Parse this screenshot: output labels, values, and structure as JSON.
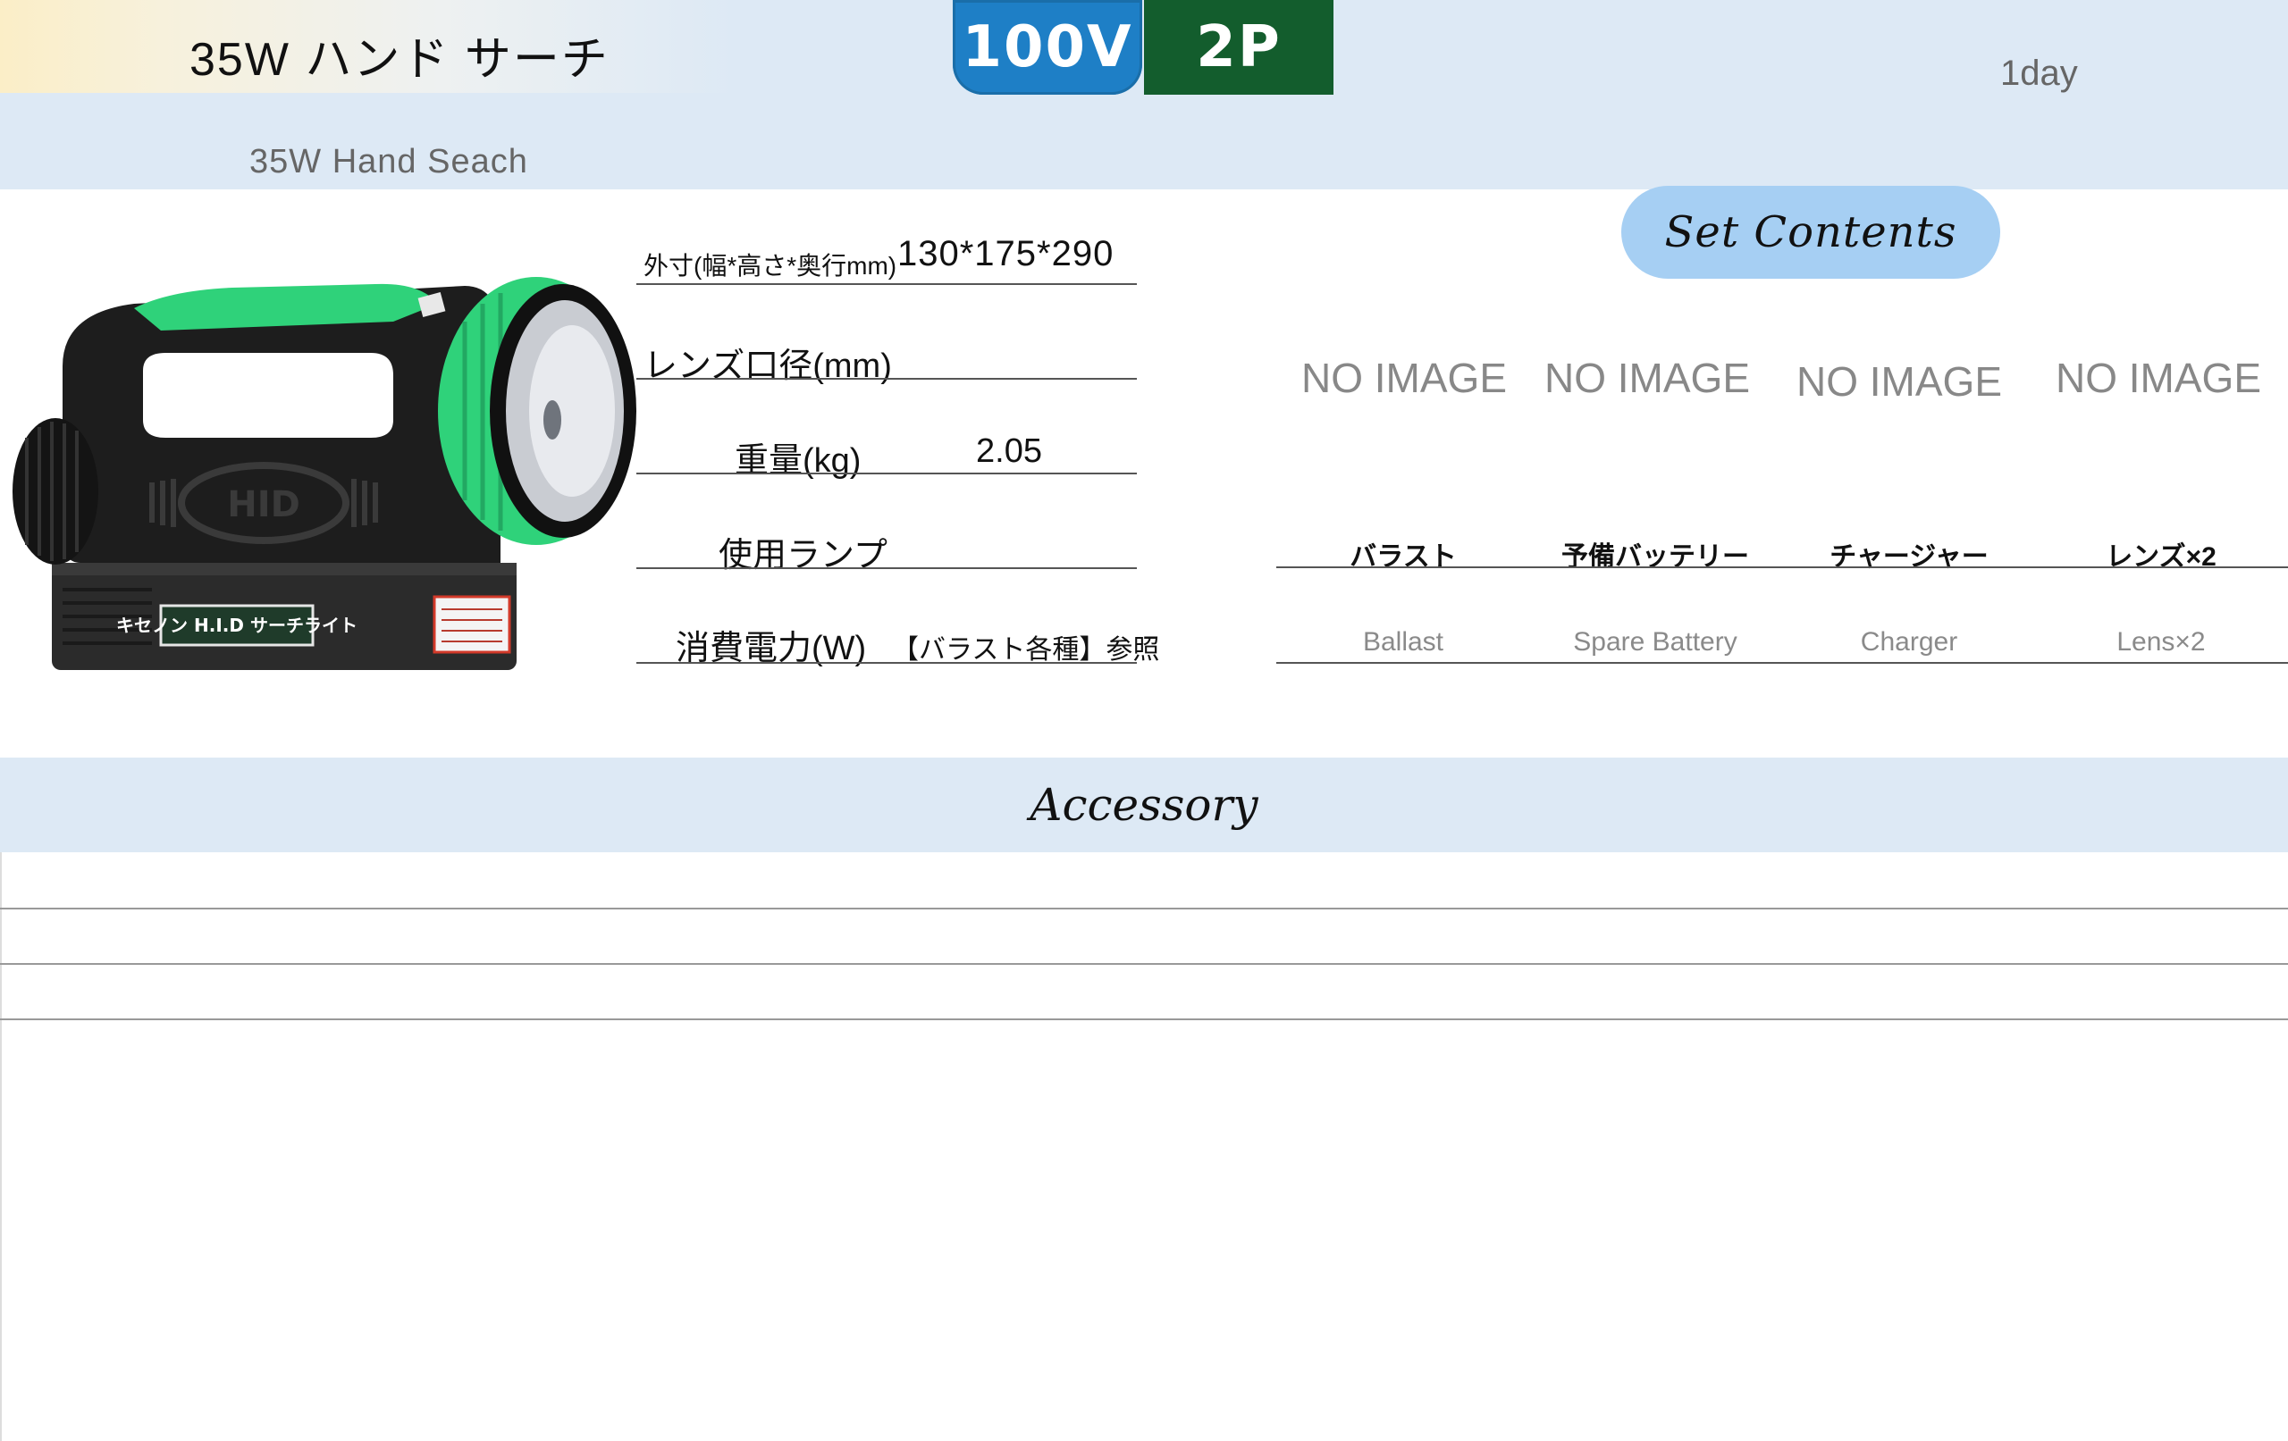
{
  "header": {
    "title": "35W ハンド サーチ",
    "subtitle": "35W Hand Seach",
    "voltage_badge": "100V",
    "plug_badge": "2P",
    "rental_days": "1day"
  },
  "product": {
    "image_label": "キセノン H.I.D サーチライト",
    "logo_text": "HID"
  },
  "specs": {
    "dimensions_label": "外寸(幅*高さ*奥行mm)",
    "dimensions_value": "130*175*290",
    "lens_label": "レンズ口径(mm)",
    "lens_value": "",
    "weight_label": "重量(kg)",
    "weight_value": "2.05",
    "lamp_label": "使用ランプ",
    "lamp_value": "",
    "power_label": "消費電力(W)",
    "power_value": "【バラスト各種】参照"
  },
  "set_contents": {
    "title": "Set Contents",
    "items": [
      {
        "image_text": "NO IMAGE",
        "name_ja": "バラスト",
        "name_en": "Ballast"
      },
      {
        "image_text": "NO IMAGE",
        "name_ja": "予備バッテリー",
        "name_en": "Spare Battery"
      },
      {
        "image_text": "NO IMAGE",
        "name_ja": "チャージャー",
        "name_en": "Charger"
      },
      {
        "image_text": "NO IMAGE",
        "name_ja": "レンズ×2",
        "name_en": "Lens×2"
      }
    ]
  },
  "accessory": {
    "title": "Accessory",
    "rows": [
      "",
      "",
      ""
    ]
  },
  "colors": {
    "header_band": "#dde9f5",
    "voltage_badge": "#1e7fc6",
    "plug_badge": "#135d2d",
    "set_contents_pill": "#a6cff3",
    "product_accent_green": "#2fd27a"
  }
}
